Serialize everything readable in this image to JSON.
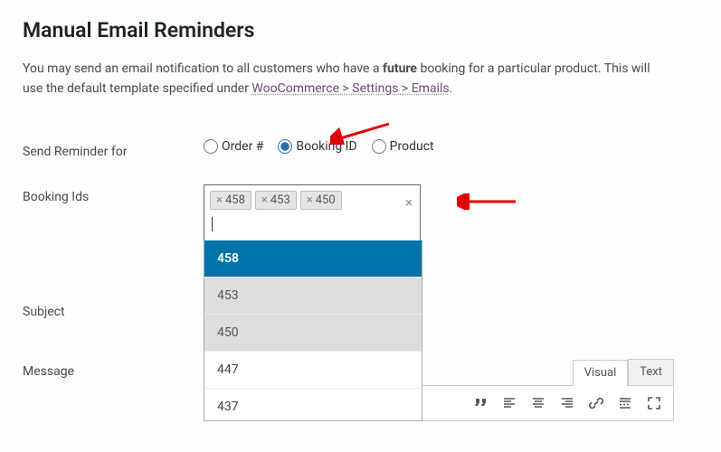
{
  "page": {
    "title": "Manual Email Reminders",
    "description_pre": "You may send an email notification to all customers who have a ",
    "description_bold": "future",
    "description_mid": " booking for a particular product. This will use the default template specified under ",
    "breadcrumb_link": "WooCommerce > Settings > Emails",
    "description_end": "."
  },
  "labels": {
    "send_reminder_for": "Send Reminder for",
    "booking_ids": "Booking Ids",
    "subject": "Subject",
    "message": "Message"
  },
  "radios": {
    "order": "Order #",
    "booking_id": "Booking ID",
    "product": "Product",
    "selected": "booking_id"
  },
  "select": {
    "tags": [
      "458",
      "453",
      "450"
    ],
    "options": [
      {
        "value": "458",
        "state": "selected"
      },
      {
        "value": "453",
        "state": "chosen"
      },
      {
        "value": "450",
        "state": "chosen"
      },
      {
        "value": "447",
        "state": "normal"
      },
      {
        "value": "437",
        "state": "normal"
      }
    ]
  },
  "editor": {
    "tab_visual": "Visual",
    "tab_text": "Text"
  },
  "icons": {
    "quote": "❝",
    "align_left": "≡",
    "align_center": "≡",
    "align_right": "≡",
    "link": "🔗",
    "more": "▤",
    "fullscreen": "⛶"
  }
}
